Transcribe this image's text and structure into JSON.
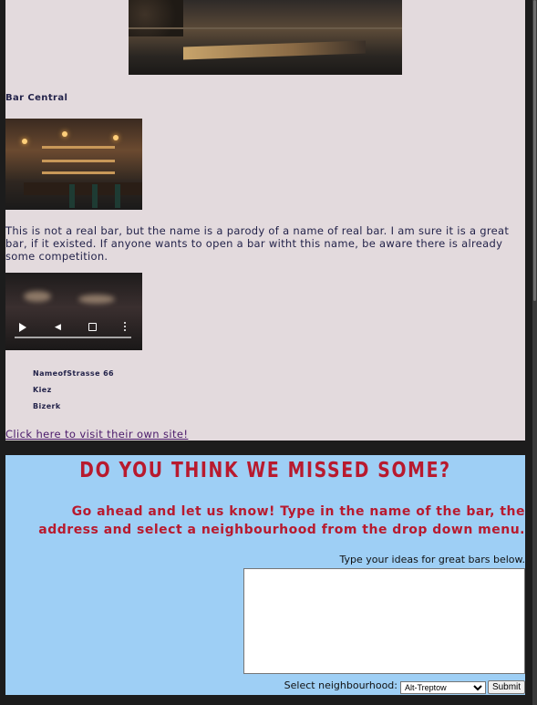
{
  "bar": {
    "title": "Bar Central",
    "description": "This is not a real bar, but the name is a parody of a name of real bar. I am sure it is a great bar, if it existed. If anyone wants to open a bar witht this name, be aware there is already some competition.",
    "address": [
      "NameofStrasse 66",
      "Kiez",
      "Bizerk"
    ],
    "link_text": "Click here to visit their own site!"
  },
  "suggest": {
    "heading": "DO YOU THINK WE MISSED SOME?",
    "subheading": "Go ahead and let us know! Type in the name of the bar, the address and select a neighbourhood from the drop down menu.",
    "textarea_label": "Type your ideas for great bars below.",
    "textarea_value": "",
    "select_label": "Select neighbourhood:",
    "select_value": "Alt-Treptow",
    "submit_label": "Submit"
  },
  "colors": {
    "bar_section_bg": "#e3dadd",
    "suggest_section_bg": "#9ecff5",
    "heading_red": "#b81a2e",
    "text_navy": "#23234a",
    "link_purple": "#4a1a6a"
  },
  "icons": {
    "video_play": "play-icon",
    "video_volume": "volume-icon",
    "video_fullscreen": "fullscreen-icon",
    "video_more": "more-vertical-icon"
  }
}
